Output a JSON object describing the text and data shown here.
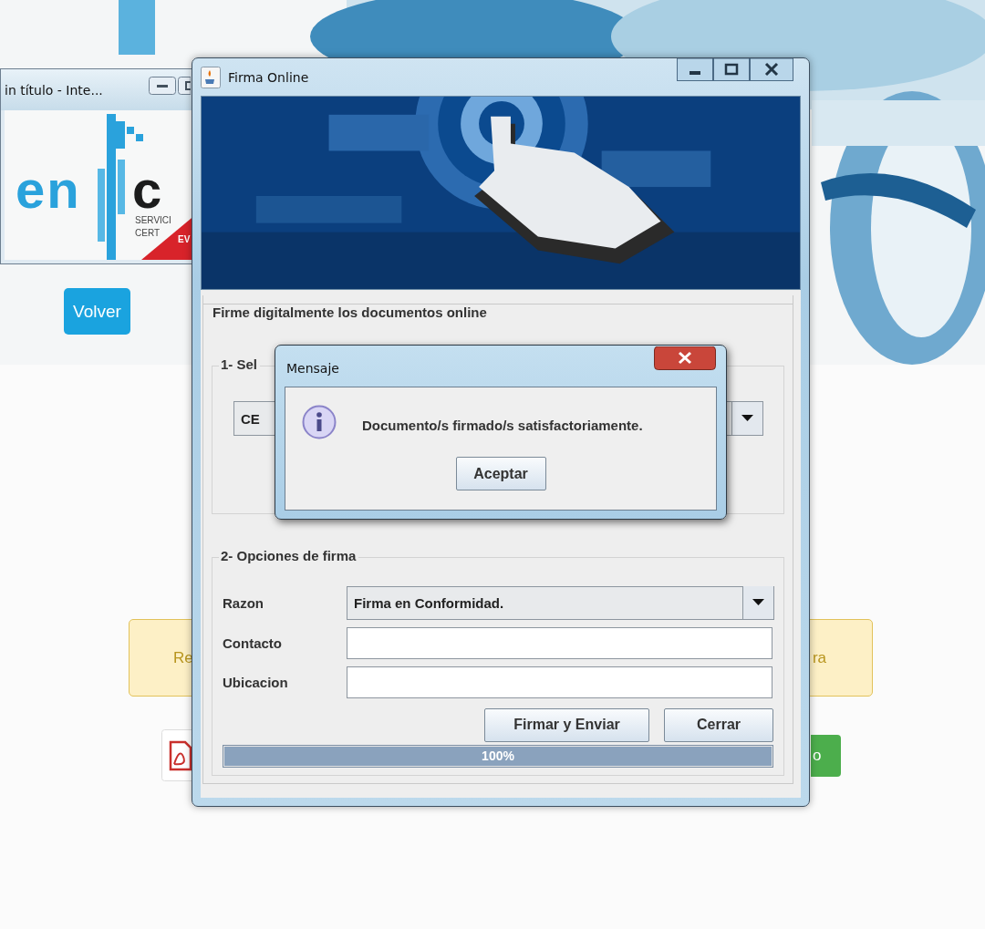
{
  "background_page": {
    "back_button": "Volver",
    "notice": {
      "text_left": "Re",
      "text_right": "ra"
    },
    "green_button": "o"
  },
  "browser_window": {
    "title": "in título - Inte...",
    "logo": {
      "brand_1": "en",
      "brand_2": "c",
      "line_1": "SERVICI",
      "line_2": "CERT",
      "badge": "EV"
    }
  },
  "main_window": {
    "title": "Firma Online",
    "panel_title": "Firme digitalmente los documentos online",
    "section_1": {
      "legend": "1- Sel",
      "certificate": "CE"
    },
    "section_2": {
      "legend": "2- Opciones de firma",
      "fields": [
        {
          "kind": "select",
          "label": "Razon",
          "value": "Firma en Conformidad."
        },
        {
          "kind": "text",
          "label": "Contacto"
        },
        {
          "kind": "text",
          "label": "Ubicacion"
        }
      ],
      "buttons": [
        "Firmar y Enviar",
        "Cerrar"
      ],
      "progress": {
        "level": 1,
        "reading": "100%"
      }
    }
  },
  "dialog": {
    "title": "Mensaje",
    "message": "Documento/s firmado/s satisfactoriamente.",
    "button": "Aceptar"
  }
}
